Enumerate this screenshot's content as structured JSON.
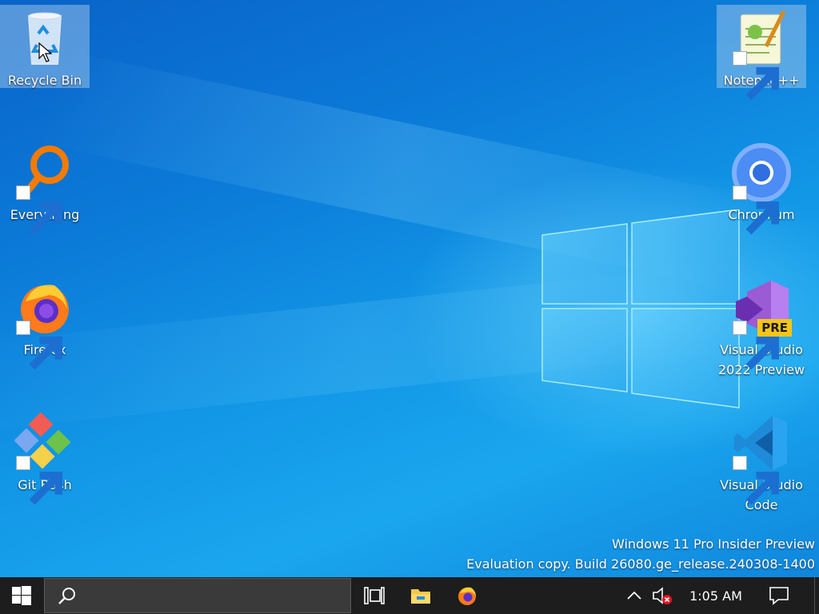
{
  "desktop": {
    "icons_left": [
      {
        "label": "Recycle Bin",
        "icon": "recycle-bin-icon"
      },
      {
        "label": "Everything",
        "icon": "everything-icon"
      },
      {
        "label": "Firefox",
        "icon": "firefox-icon"
      },
      {
        "label": "Git Bash",
        "icon": "git-bash-icon"
      }
    ],
    "icons_right": [
      {
        "label": "Notepad++",
        "icon": "notepad-plus-plus-icon"
      },
      {
        "label": "Chromium",
        "icon": "chromium-icon"
      },
      {
        "label_line1": "Visual Studio",
        "label_line2": "2022 Preview",
        "icon": "visual-studio-preview-icon",
        "badge": "PRE"
      },
      {
        "label_line1": "Visual Studio",
        "label_line2": "Code",
        "icon": "vscode-icon"
      }
    ]
  },
  "watermark": {
    "line1": "Windows 11 Pro Insider Preview",
    "line2": "Evaluation copy. Build 26080.ge_release.240308-1400"
  },
  "taskbar": {
    "search_placeholder": "",
    "clock": "1:05 AM",
    "pinned": [
      "task-view-icon",
      "file-explorer-icon",
      "firefox-icon"
    ],
    "tray": [
      "chevron-up-icon",
      "volume-muted-icon",
      "notification-icon"
    ]
  },
  "colors": {
    "accent": "#0a78d7",
    "taskbar": "#1d1d1d"
  }
}
